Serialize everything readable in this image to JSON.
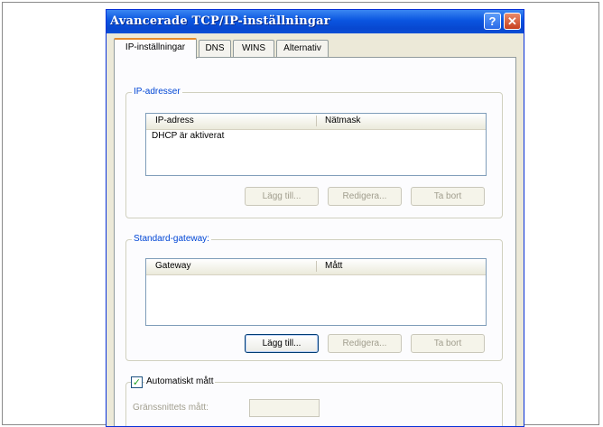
{
  "window": {
    "title": "Avancerade TCP/IP-inställningar",
    "help_glyph": "?",
    "close_glyph": "✕"
  },
  "tabs": [
    {
      "label": "IP-inställningar",
      "active": true
    },
    {
      "label": "DNS",
      "active": false
    },
    {
      "label": "WINS",
      "active": false
    },
    {
      "label": "Alternativ",
      "active": false
    }
  ],
  "ip_group": {
    "label": "IP-adresser",
    "columns": [
      "IP-adress",
      "Nätmask"
    ],
    "rows": [
      "DHCP är aktiverat"
    ],
    "buttons": {
      "add": "Lägg till...",
      "edit": "Redigera...",
      "remove": "Ta bort"
    }
  },
  "gateway_group": {
    "label": "Standard-gateway:",
    "columns": [
      "Gateway",
      "Mått"
    ],
    "buttons": {
      "add": "Lägg till...",
      "edit": "Redigera...",
      "remove": "Ta bort"
    }
  },
  "metric": {
    "checkbox_label": "Automatiskt mått",
    "checked": true,
    "field_label": "Gränssnittets mått:",
    "field_value": ""
  },
  "colors": {
    "titlebar": "#0a55e0",
    "group_label": "#0046d5",
    "tab_highlight": "#e68b2c"
  }
}
